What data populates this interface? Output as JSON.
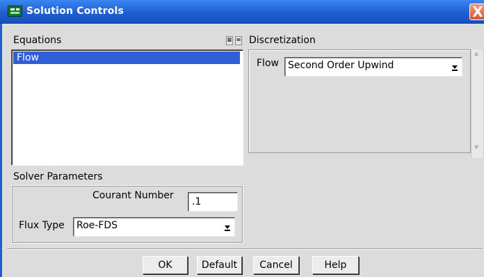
{
  "window": {
    "title": "Solution Controls",
    "close_glyph": "X"
  },
  "equations": {
    "heading": "Equations",
    "items": [
      "Flow"
    ]
  },
  "discretization": {
    "heading": "Discretization",
    "rows": [
      {
        "label": "Flow",
        "value": "Second Order Upwind"
      }
    ]
  },
  "solver": {
    "heading": "Solver Parameters",
    "courant_label": "Courant Number",
    "courant_value": ".1",
    "flux_label": "Flux Type",
    "flux_value": "Roe-FDS"
  },
  "buttons": {
    "ok": "OK",
    "default": "Default",
    "cancel": "Cancel",
    "help": "Help"
  },
  "colors": {
    "titlebar": "#1f5fd1",
    "selection": "#2e5fd6",
    "close": "#d9532e"
  }
}
